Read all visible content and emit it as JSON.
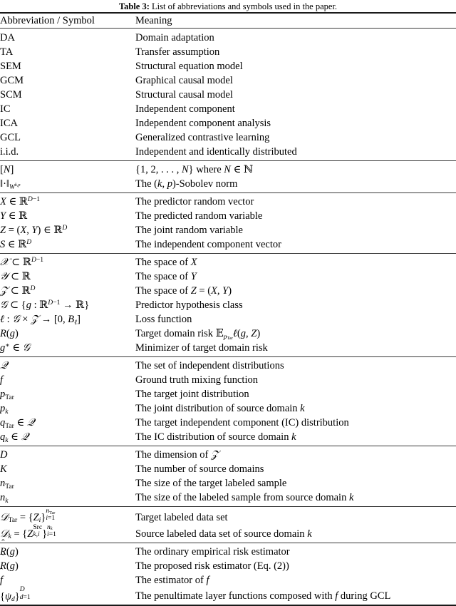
{
  "caption": {
    "label": "Table 3:",
    "text": "List of abbreviations and symbols used in the paper."
  },
  "columns": {
    "symbol": "Abbreviation / Symbol",
    "meaning": "Meaning"
  },
  "sections": [
    {
      "name": "abbreviations",
      "rows": [
        {
          "symbol": "DA",
          "meaning": "Domain adaptation"
        },
        {
          "symbol": "TA",
          "meaning": "Transfer assumption"
        },
        {
          "symbol": "SEM",
          "meaning": "Structural equation model"
        },
        {
          "symbol": "GCM",
          "meaning": "Graphical causal model"
        },
        {
          "symbol": "SCM",
          "meaning": "Structural causal model"
        },
        {
          "symbol": "IC",
          "meaning": "Independent component"
        },
        {
          "symbol": "ICA",
          "meaning": "Independent component analysis"
        },
        {
          "symbol": "GCL",
          "meaning": "Generalized contrastive learning"
        },
        {
          "symbol": "i.i.d.",
          "meaning": "Independent and identically distributed"
        }
      ]
    },
    {
      "name": "notation",
      "rows": [
        {
          "symbol": "[N]",
          "meaning": "{1, 2, . . . , N} where N ∈ ℕ"
        },
        {
          "symbol": "‖·‖_{W^{k,p}}",
          "meaning": "The (k, p)-Sobolev norm"
        }
      ]
    },
    {
      "name": "random-variables",
      "rows": [
        {
          "symbol": "X ∈ ℝ^{D−1}",
          "meaning": "The predictor random vector"
        },
        {
          "symbol": "Y ∈ ℝ",
          "meaning": "The predicted random variable"
        },
        {
          "symbol": "Z = (X, Y) ∈ ℝ^D",
          "meaning": "The joint random variable"
        },
        {
          "symbol": "S ∈ ℝ^D",
          "meaning": "The independent component vector"
        }
      ]
    },
    {
      "name": "spaces",
      "rows": [
        {
          "symbol": "𝒳 ⊂ ℝ^{D−1}",
          "meaning": "The space of X"
        },
        {
          "symbol": "𝒴 ⊂ ℝ",
          "meaning": "The space of Y"
        },
        {
          "symbol": "𝒵 ⊂ ℝ^D",
          "meaning": "The space of Z = (X, Y)"
        },
        {
          "symbol": "𝒢 ⊂ {g : ℝ^{D−1} → ℝ}",
          "meaning": "Predictor hypothesis class"
        },
        {
          "symbol": "ℓ : 𝒢 × 𝒵 → [0, B_ℓ]",
          "meaning": "Loss function"
        },
        {
          "symbol": "R(g)",
          "meaning": "Target domain risk 𝔼_{p_Tar} ℓ(g, Z)"
        },
        {
          "symbol": "g* ∈ 𝒢",
          "meaning": "Minimizer of target domain risk"
        }
      ]
    },
    {
      "name": "distributions",
      "rows": [
        {
          "symbol": "𝒬",
          "meaning": "The set of independent distributions"
        },
        {
          "symbol": "f",
          "meaning": "Ground truth mixing function"
        },
        {
          "symbol": "p_{Tar}",
          "meaning": "The target joint distribution"
        },
        {
          "symbol": "p_k",
          "meaning": "The joint distribution of source domain k"
        },
        {
          "symbol": "q_{Tar} ∈ 𝒬",
          "meaning": "The target independent component (IC) distribution"
        },
        {
          "symbol": "q_k ∈ 𝒬",
          "meaning": "The IC distribution of source domain k"
        }
      ]
    },
    {
      "name": "dimensions",
      "rows": [
        {
          "symbol": "D",
          "meaning": "The dimension of 𝒵"
        },
        {
          "symbol": "K",
          "meaning": "The number of source domains"
        },
        {
          "symbol": "n_{Tar}",
          "meaning": "The size of the target labeled sample"
        },
        {
          "symbol": "n_k",
          "meaning": "The size of the labeled sample from source domain k"
        }
      ]
    },
    {
      "name": "data-sets",
      "rows": [
        {
          "symbol": "𝒟_{Tar} = {Z_i}_{i=1}^{n_Tar}",
          "meaning": "Target labeled data set"
        },
        {
          "symbol": "𝒟_k = {Z^{Src}_{k,i}}_{i=1}^{n_k}",
          "meaning": "Source labeled data set of source domain k"
        }
      ]
    },
    {
      "name": "estimators",
      "rows": [
        {
          "symbol": "R̂(g)",
          "meaning": "The ordinary empirical risk estimator"
        },
        {
          "symbol": "Ř(g)",
          "meaning": "The proposed risk estimator (Eq. (2))"
        },
        {
          "symbol": "f̂",
          "meaning": "The estimator of f"
        },
        {
          "symbol": "{ψ_d}_{d=1}^{D}",
          "meaning": "The penultimate layer functions composed with f during GCL"
        }
      ]
    }
  ],
  "colors": {
    "text": "#000000",
    "rule_major": "#1a1a1a",
    "rule_minor": "#3a3a3a",
    "background": "#ffffff"
  }
}
